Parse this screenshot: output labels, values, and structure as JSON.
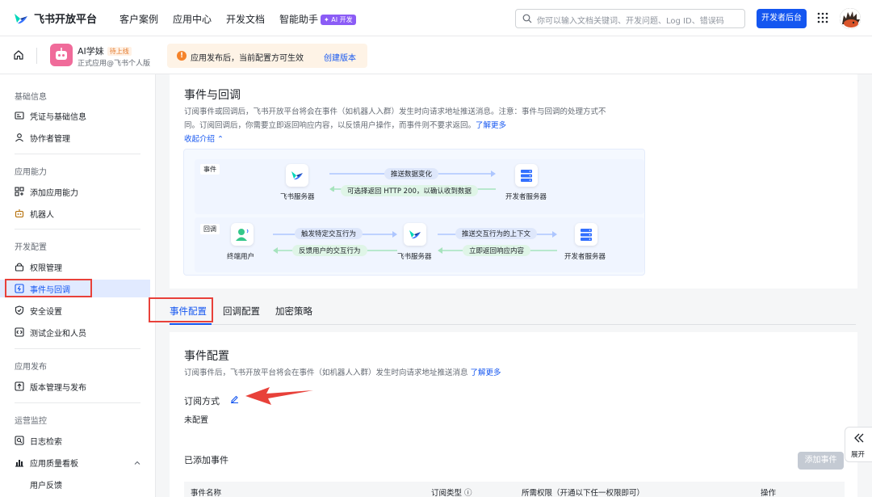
{
  "nav": {
    "logo": "飞书开放平台",
    "items": [
      "客户案例",
      "应用中心",
      "开发文档",
      "智能助手"
    ],
    "ai_badge": "✦ AI 开发",
    "search_placeholder": "你可以输入文档关键词、开发问题、Log ID、错误码",
    "dev_console": "开发者后台"
  },
  "app": {
    "name": "AI学妹",
    "status": "待上线",
    "subtitle": "正式应用@飞书个人版",
    "notice": "应用发布后，当前配置方可生效",
    "notice_link": "创建版本"
  },
  "sidebar": {
    "sections": [
      {
        "title": "基础信息",
        "items": [
          {
            "label": "凭证与基础信息",
            "icon": "credential-icon"
          },
          {
            "label": "协作者管理",
            "icon": "user-icon"
          }
        ]
      },
      {
        "title": "应用能力",
        "items": [
          {
            "label": "添加应用能力",
            "icon": "apps-add-icon"
          },
          {
            "label": "机器人",
            "icon": "bot-icon"
          }
        ]
      },
      {
        "title": "开发配置",
        "items": [
          {
            "label": "权限管理",
            "icon": "lock-icon"
          },
          {
            "label": "事件与回调",
            "icon": "event-icon"
          },
          {
            "label": "安全设置",
            "icon": "shield-icon"
          },
          {
            "label": "测试企业和人员",
            "icon": "code-icon"
          }
        ]
      },
      {
        "title": "应用发布",
        "items": [
          {
            "label": "版本管理与发布",
            "icon": "upload-icon"
          }
        ]
      },
      {
        "title": "运营监控",
        "items": [
          {
            "label": "日志检索",
            "icon": "log-icon"
          },
          {
            "label": "应用质量看板",
            "icon": "chart-icon"
          },
          {
            "label": "用户反馈",
            "icon": ""
          }
        ]
      }
    ]
  },
  "intro": {
    "title": "事件与回调",
    "desc1": "订阅事件或回调后，飞书开放平台将会在事件（如机器人入群）发生时向请求地址推送消息。注意：事件与回调的处理方式不",
    "desc2": "同。订阅回调后，你需要立即返回响应内容，以反馈用户操作，而事件则不要求返回。",
    "learn_more": "了解更多",
    "collapse": "收起介绍 ⌃"
  },
  "diagram": {
    "event_tag": "事件",
    "callback_tag": "回调",
    "feishu_server": "飞书服务器",
    "dev_server": "开发者服务器",
    "end_user": "终端用户",
    "push_data": "推送数据变化",
    "return_200": "可选择返回 HTTP 200，以确认收到数据",
    "trigger": "触发特定交互行为",
    "feedback": "反馈用户的交互行为",
    "push_context": "推送交互行为的上下文",
    "return_now": "立即返回响应内容"
  },
  "tabs": [
    "事件配置",
    "回调配置",
    "加密策略"
  ],
  "event_config": {
    "title": "事件配置",
    "desc": "订阅事件后，飞书开放平台将会在事件（如机器人入群）发生时向请求地址推送消息",
    "learn_more": "了解更多",
    "sub_mode_label": "订阅方式",
    "sub_mode_value": "未配置",
    "added_title": "已添加事件",
    "add_button": "添加事件",
    "columns": [
      "事件名称",
      "订阅类型 ⓘ",
      "所需权限（开通以下任一权限即可）",
      "操作"
    ]
  },
  "expand": "展开",
  "colors": {
    "primary": "#1456f0",
    "highlight": "#e8413a",
    "active_bg": "#e1eaff"
  }
}
